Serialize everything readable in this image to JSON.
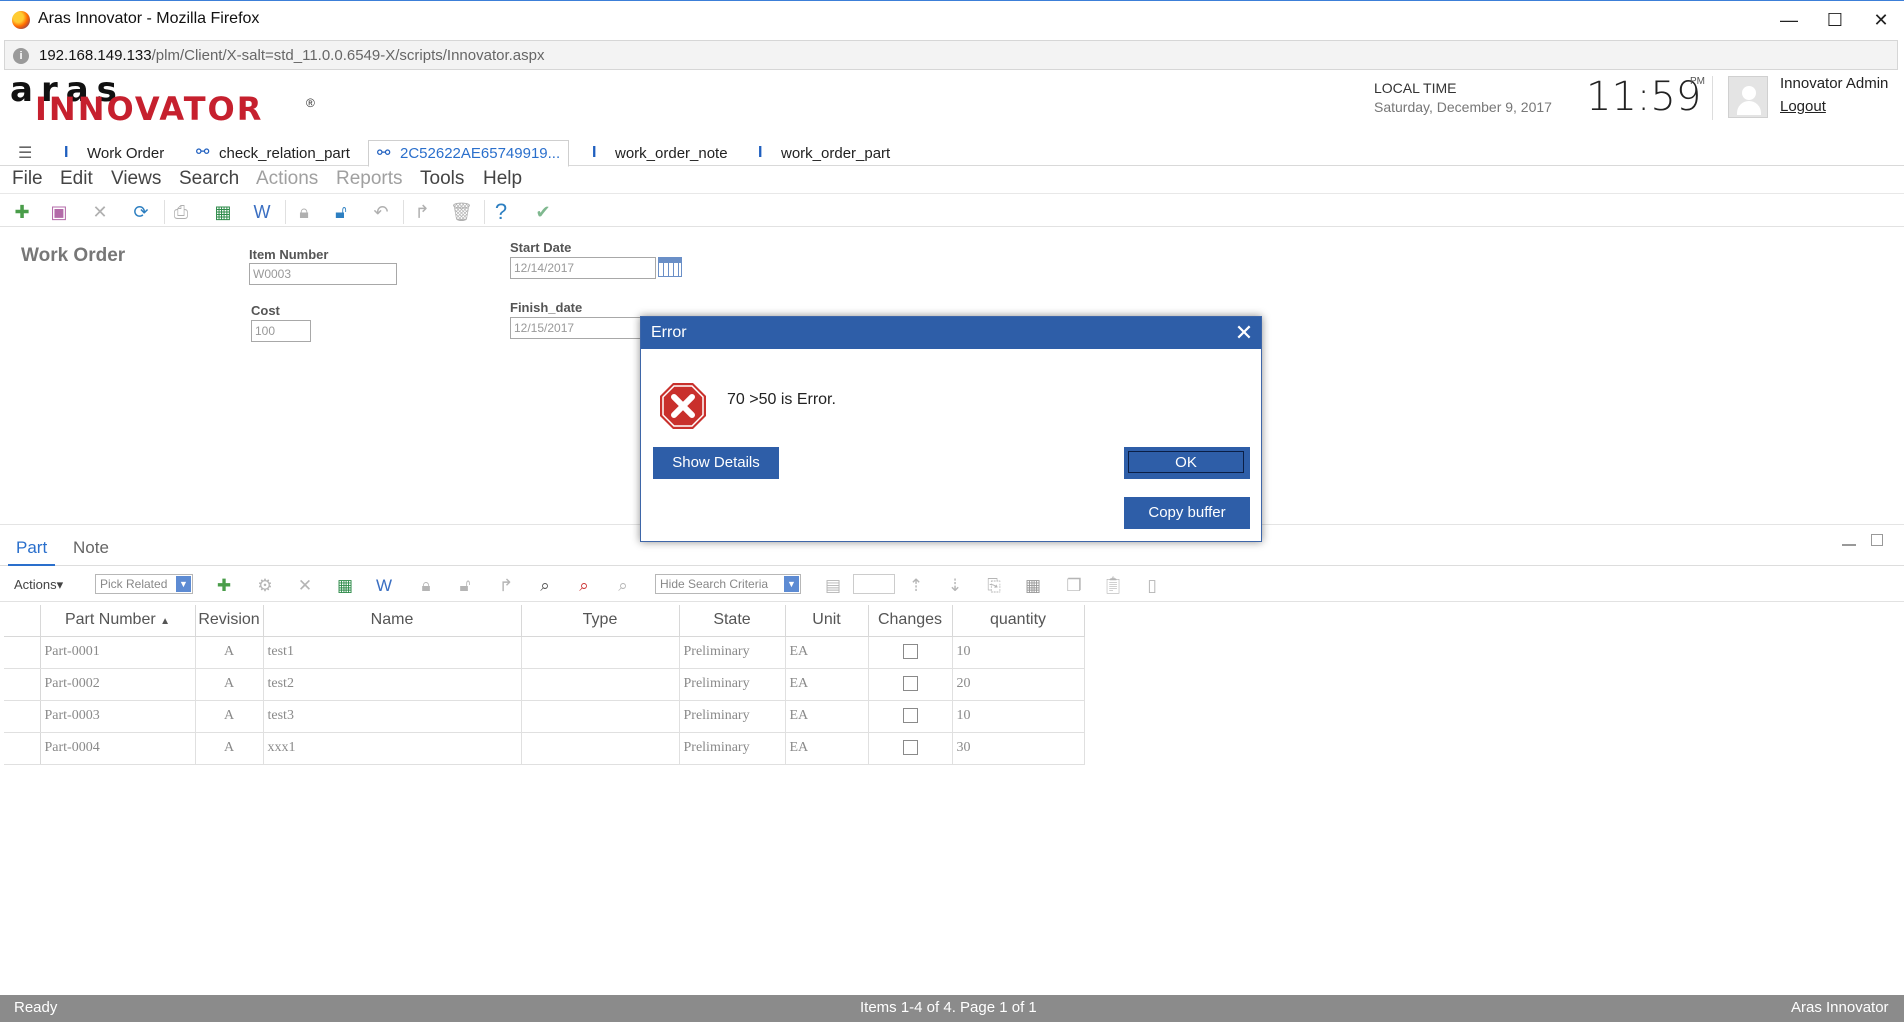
{
  "browser": {
    "window_title": "Aras Innovator - Mozilla Firefox",
    "url_host": "192.168.149.133",
    "url_path": "/plm/Client/X-salt=std_11.0.0.6549-X/scripts/Innovator.aspx",
    "min_glyph": "—",
    "max_glyph": "☐",
    "close_glyph": "✕"
  },
  "header": {
    "logo_top": "aras",
    "logo_main": "INNOVATOR",
    "logo_reg": "®",
    "local_time_label": "LOCAL TIME",
    "local_date": "Saturday, December 9, 2017",
    "clock": "11:59",
    "ampm": "PM",
    "user_name": "Innovator Admin",
    "logout_label": "Logout"
  },
  "tabs": [
    {
      "label": "Work Order",
      "icon": "itemtype-icon"
    },
    {
      "label": "check_relation_part",
      "icon": "relationship-icon"
    },
    {
      "label": "2C52622AE65749919...",
      "icon": "relationship-icon"
    },
    {
      "label": "work_order_note",
      "icon": "itemtype-icon"
    },
    {
      "label": "work_order_part",
      "icon": "itemtype-icon"
    }
  ],
  "menu": [
    "File",
    "Edit",
    "Views",
    "Search",
    "Actions",
    "Reports",
    "Tools",
    "Help"
  ],
  "form": {
    "title": "Work Order",
    "item_number_label": "Item Number",
    "item_number_value": "W0003",
    "cost_label": "Cost",
    "cost_value": "100",
    "start_date_label": "Start Date",
    "start_date_value": "12/14/2017",
    "finish_date_label": "Finish_date",
    "finish_date_value": "12/15/2017"
  },
  "relationships": {
    "tabs": [
      "Part",
      "Note"
    ],
    "actions_label": "Actions",
    "pick_related_label": "Pick Related",
    "hide_search_label": "Hide Search Criteria",
    "columns": [
      "Part Number",
      "Revision",
      "Name",
      "Type",
      "State",
      "Unit",
      "Changes",
      "quantity"
    ],
    "sort_indicator": "▲",
    "rows": [
      {
        "part_number": "Part-0001",
        "revision": "A",
        "name": "test1",
        "type": "",
        "state": "Preliminary",
        "unit": "EA",
        "quantity": "10"
      },
      {
        "part_number": "Part-0002",
        "revision": "A",
        "name": "test2",
        "type": "",
        "state": "Preliminary",
        "unit": "EA",
        "quantity": "20"
      },
      {
        "part_number": "Part-0003",
        "revision": "A",
        "name": "test3",
        "type": "",
        "state": "Preliminary",
        "unit": "EA",
        "quantity": "10"
      },
      {
        "part_number": "Part-0004",
        "revision": "A",
        "name": "xxx1",
        "type": "",
        "state": "Preliminary",
        "unit": "EA",
        "quantity": "30"
      }
    ]
  },
  "status": {
    "left": "Ready",
    "center": "Items 1-4 of 4. Page 1 of 1",
    "right": "Aras Innovator"
  },
  "dialog": {
    "title": "Error",
    "close_glyph": "✕",
    "message": "70 >50 is Error.",
    "show_details_label": "Show Details",
    "ok_label": "OK",
    "copy_buffer_label": "Copy buffer"
  },
  "colors": {
    "dialog_blue": "#2e5ea8",
    "brand_red": "#c6202e",
    "status_gray": "#8b8b8b",
    "link_blue": "#2a6fcc"
  }
}
